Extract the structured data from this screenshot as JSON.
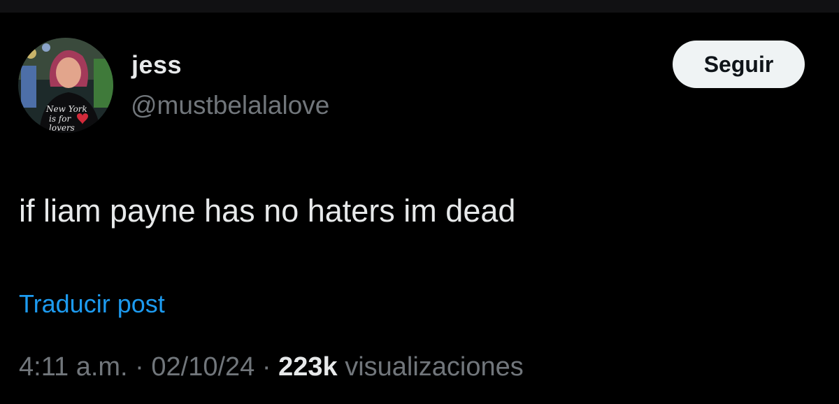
{
  "author": {
    "display_name": "jess",
    "handle": "@mustbelalalove",
    "avatar_text": [
      "New York",
      "is for",
      "lovers"
    ]
  },
  "follow_button": {
    "label": "Seguir"
  },
  "tweet": {
    "text": "if liam payne has no haters im dead"
  },
  "translate": {
    "label": "Traducir post"
  },
  "meta": {
    "time": "4:11 a.m.",
    "separator": "·",
    "date": "02/10/24",
    "views_count": "223k",
    "views_label": "visualizaciones"
  },
  "colors": {
    "background": "#000000",
    "primary_text": "#e7e9ea",
    "secondary_text": "#71767b",
    "link": "#1d9bf0",
    "button_bg": "#eff3f4"
  }
}
